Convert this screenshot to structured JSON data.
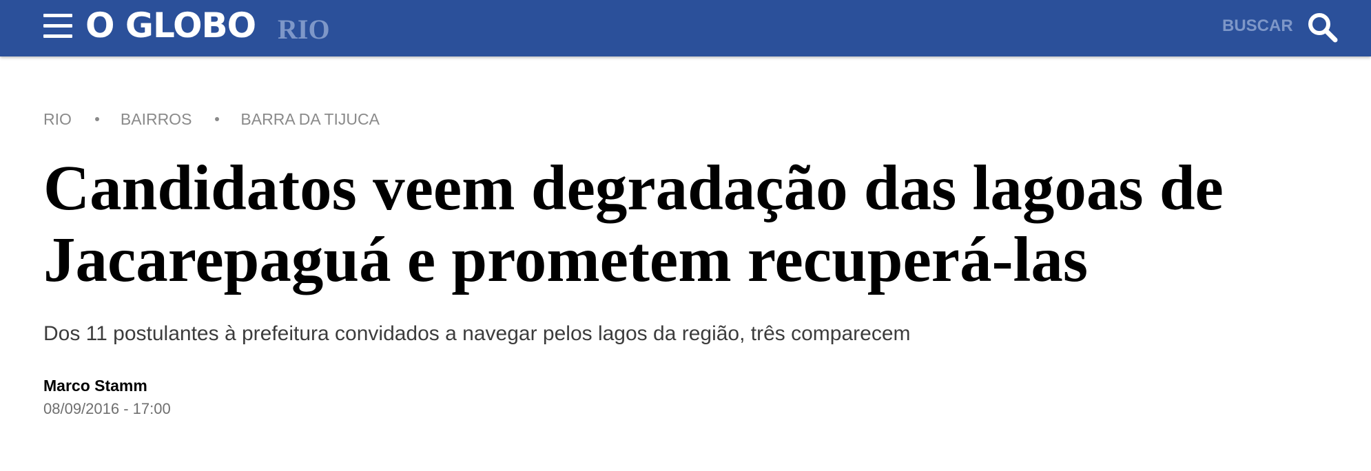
{
  "header": {
    "logo_text": "O GLOBO",
    "section": "RIO",
    "search_label": "BUSCAR",
    "background_color": "#2b509a",
    "menu_icon": "hamburger-menu-icon",
    "search_icon": "magnifier-search-icon"
  },
  "breadcrumb": {
    "items": [
      {
        "label": "RIO"
      },
      {
        "label": "BAIRROS"
      },
      {
        "label": "BARRA DA TIJUCA"
      }
    ]
  },
  "article": {
    "headline": "Candidatos veem degradação das lagoas de Jacarepaguá e prometem recuperá-las",
    "subtitle": "Dos 11 postulantes à prefeitura convidados a navegar pelos lagos da região, três comparecem",
    "author": "Marco Stamm",
    "date": "08/09/2016 - 17:00"
  }
}
